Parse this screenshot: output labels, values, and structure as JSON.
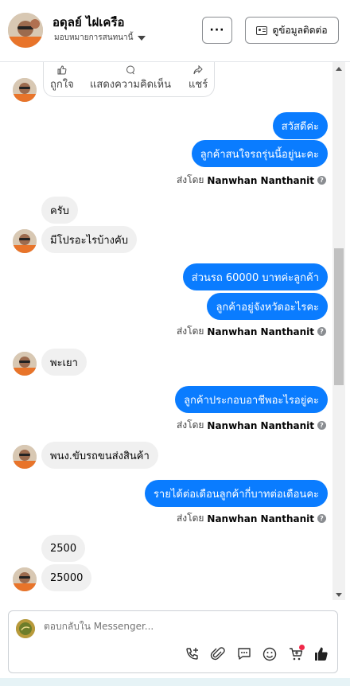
{
  "header": {
    "name": "อดุลย์ ไฝเครือ",
    "assignment": "มอบหมายการสนทนานี้",
    "more_label": "···",
    "contact_label": "ดูข้อมูลติดต่อ"
  },
  "post_actions": [
    {
      "label": "ถูกใจ",
      "icon": "like-icon"
    },
    {
      "label": "แสดงความคิดเห็น",
      "icon": "comment-icon"
    },
    {
      "label": "แชร์",
      "icon": "share-icon"
    }
  ],
  "sent_by_prefix": "ส่งโดย",
  "agent_name": "Nanwhan Nanthanit",
  "messages": {
    "out1": "สวัสดีค่ะ",
    "out2": "ลูกค้าสนใจรถรุ่นนี้อยู่นะคะ",
    "in1": "ครับ",
    "in2": "มีโปรอะไรบ้างคับ",
    "out3": "ส่วนรถ 60000 บาทค่ะลูกค้า",
    "out4": "ลูกค้าอยู่จังหวัดอะไรคะ",
    "in3": "พะเยา",
    "out5": "ลูกค้าประกอบอาชีพอะไรอยู่คะ",
    "in4": "พนง.ขับรถขนส่งสินค้า",
    "out6": "รายได้ต่อเดือนลูกค้ากี่บาทต่อเดือนคะ",
    "in5": "2500",
    "in6": "25000"
  },
  "composer": {
    "placeholder": "ตอบกลับใน Messenger..."
  },
  "colors": {
    "outgoing_bubble": "#0a7cff",
    "incoming_bubble": "#f0f0f0",
    "notification_dot": "#f02849"
  }
}
